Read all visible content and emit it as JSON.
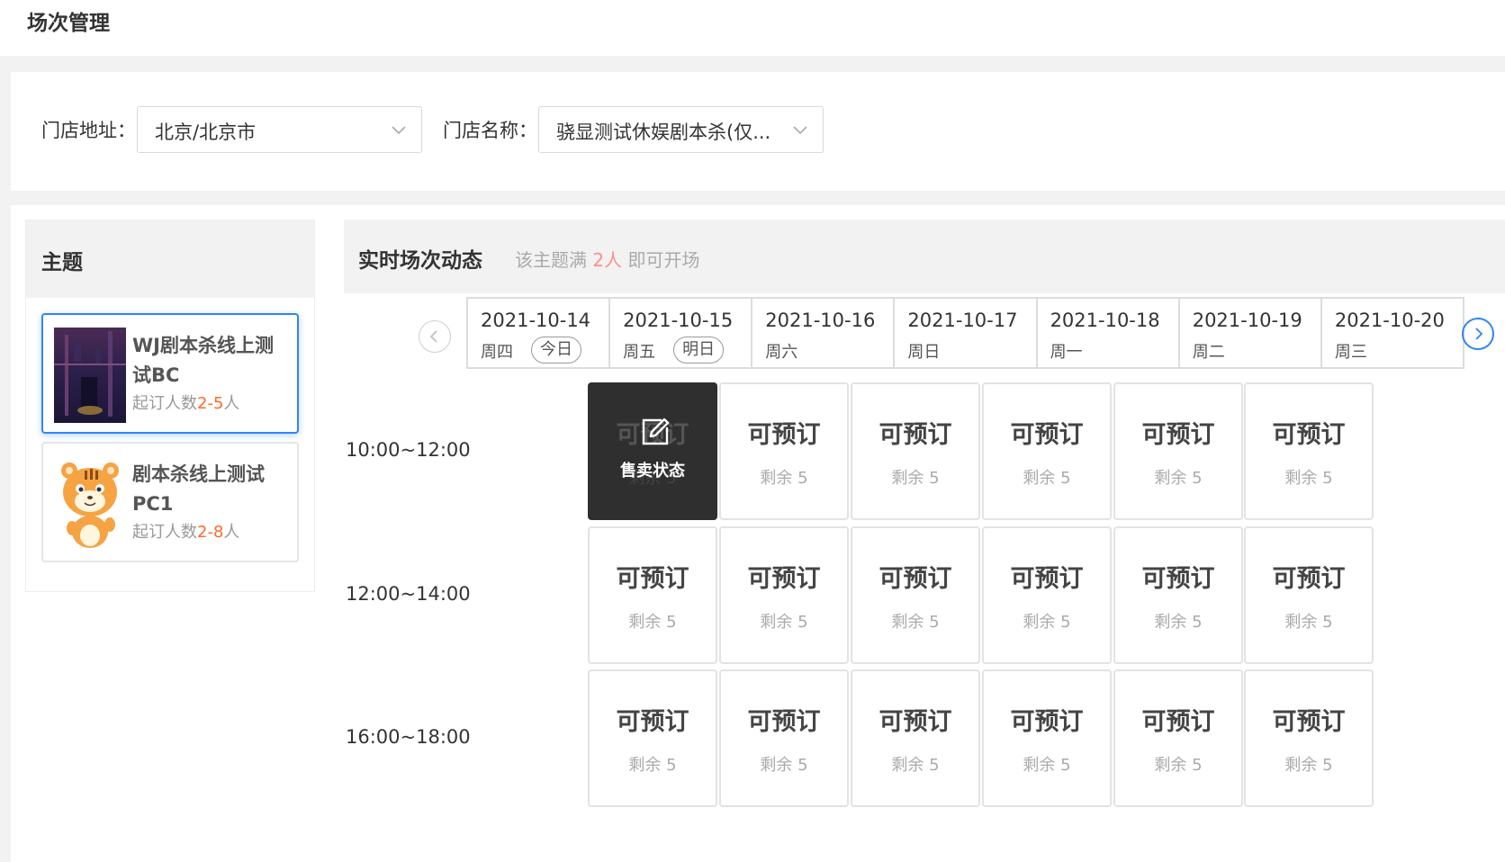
{
  "page": {
    "title": "场次管理"
  },
  "filters": {
    "address_label": "门店地址：",
    "address_value": "北京/北京市",
    "store_label": "门店名称：",
    "store_value": "骁显测试休娱剧本杀(仅..."
  },
  "themes": {
    "header": "主题",
    "items": [
      {
        "name": "WJ剧本杀线上测试BC",
        "min_prefix": "起订人数",
        "min_range": "2-5",
        "min_suffix": "人",
        "active": true
      },
      {
        "name": "剧本杀线上测试PC1",
        "min_prefix": "起订人数",
        "min_range": "2-8",
        "min_suffix": "人",
        "active": false
      }
    ]
  },
  "schedule": {
    "title": "实时场次动态",
    "hint_prefix": "该主题满",
    "hint_count": "2人",
    "hint_suffix": "即可开场",
    "dates": [
      {
        "date": "2021-10-14",
        "weekday": "周四",
        "tag": "今日"
      },
      {
        "date": "2021-10-15",
        "weekday": "周五",
        "tag": "明日"
      },
      {
        "date": "2021-10-16",
        "weekday": "周六",
        "tag": ""
      },
      {
        "date": "2021-10-17",
        "weekday": "周日",
        "tag": ""
      },
      {
        "date": "2021-10-18",
        "weekday": "周一",
        "tag": ""
      },
      {
        "date": "2021-10-19",
        "weekday": "周二",
        "tag": ""
      },
      {
        "date": "2021-10-20",
        "weekday": "周三",
        "tag": ""
      }
    ],
    "time_slots": [
      "10:00~12:00",
      "12:00~14:00",
      "16:00~18:00"
    ],
    "slot_status": "可预订",
    "slot_remaining": "剩余 5",
    "hover_action": "售卖状态"
  },
  "colors": {
    "accent": "#2f86f6",
    "highlight_orange": "#ff6a2a",
    "hint_red": "#ff8d8d",
    "hover_dark": "#2f2f2f"
  },
  "icons": [
    "chevron-down-icon",
    "chevron-left-icon",
    "chevron-right-icon",
    "edit-icon"
  ]
}
